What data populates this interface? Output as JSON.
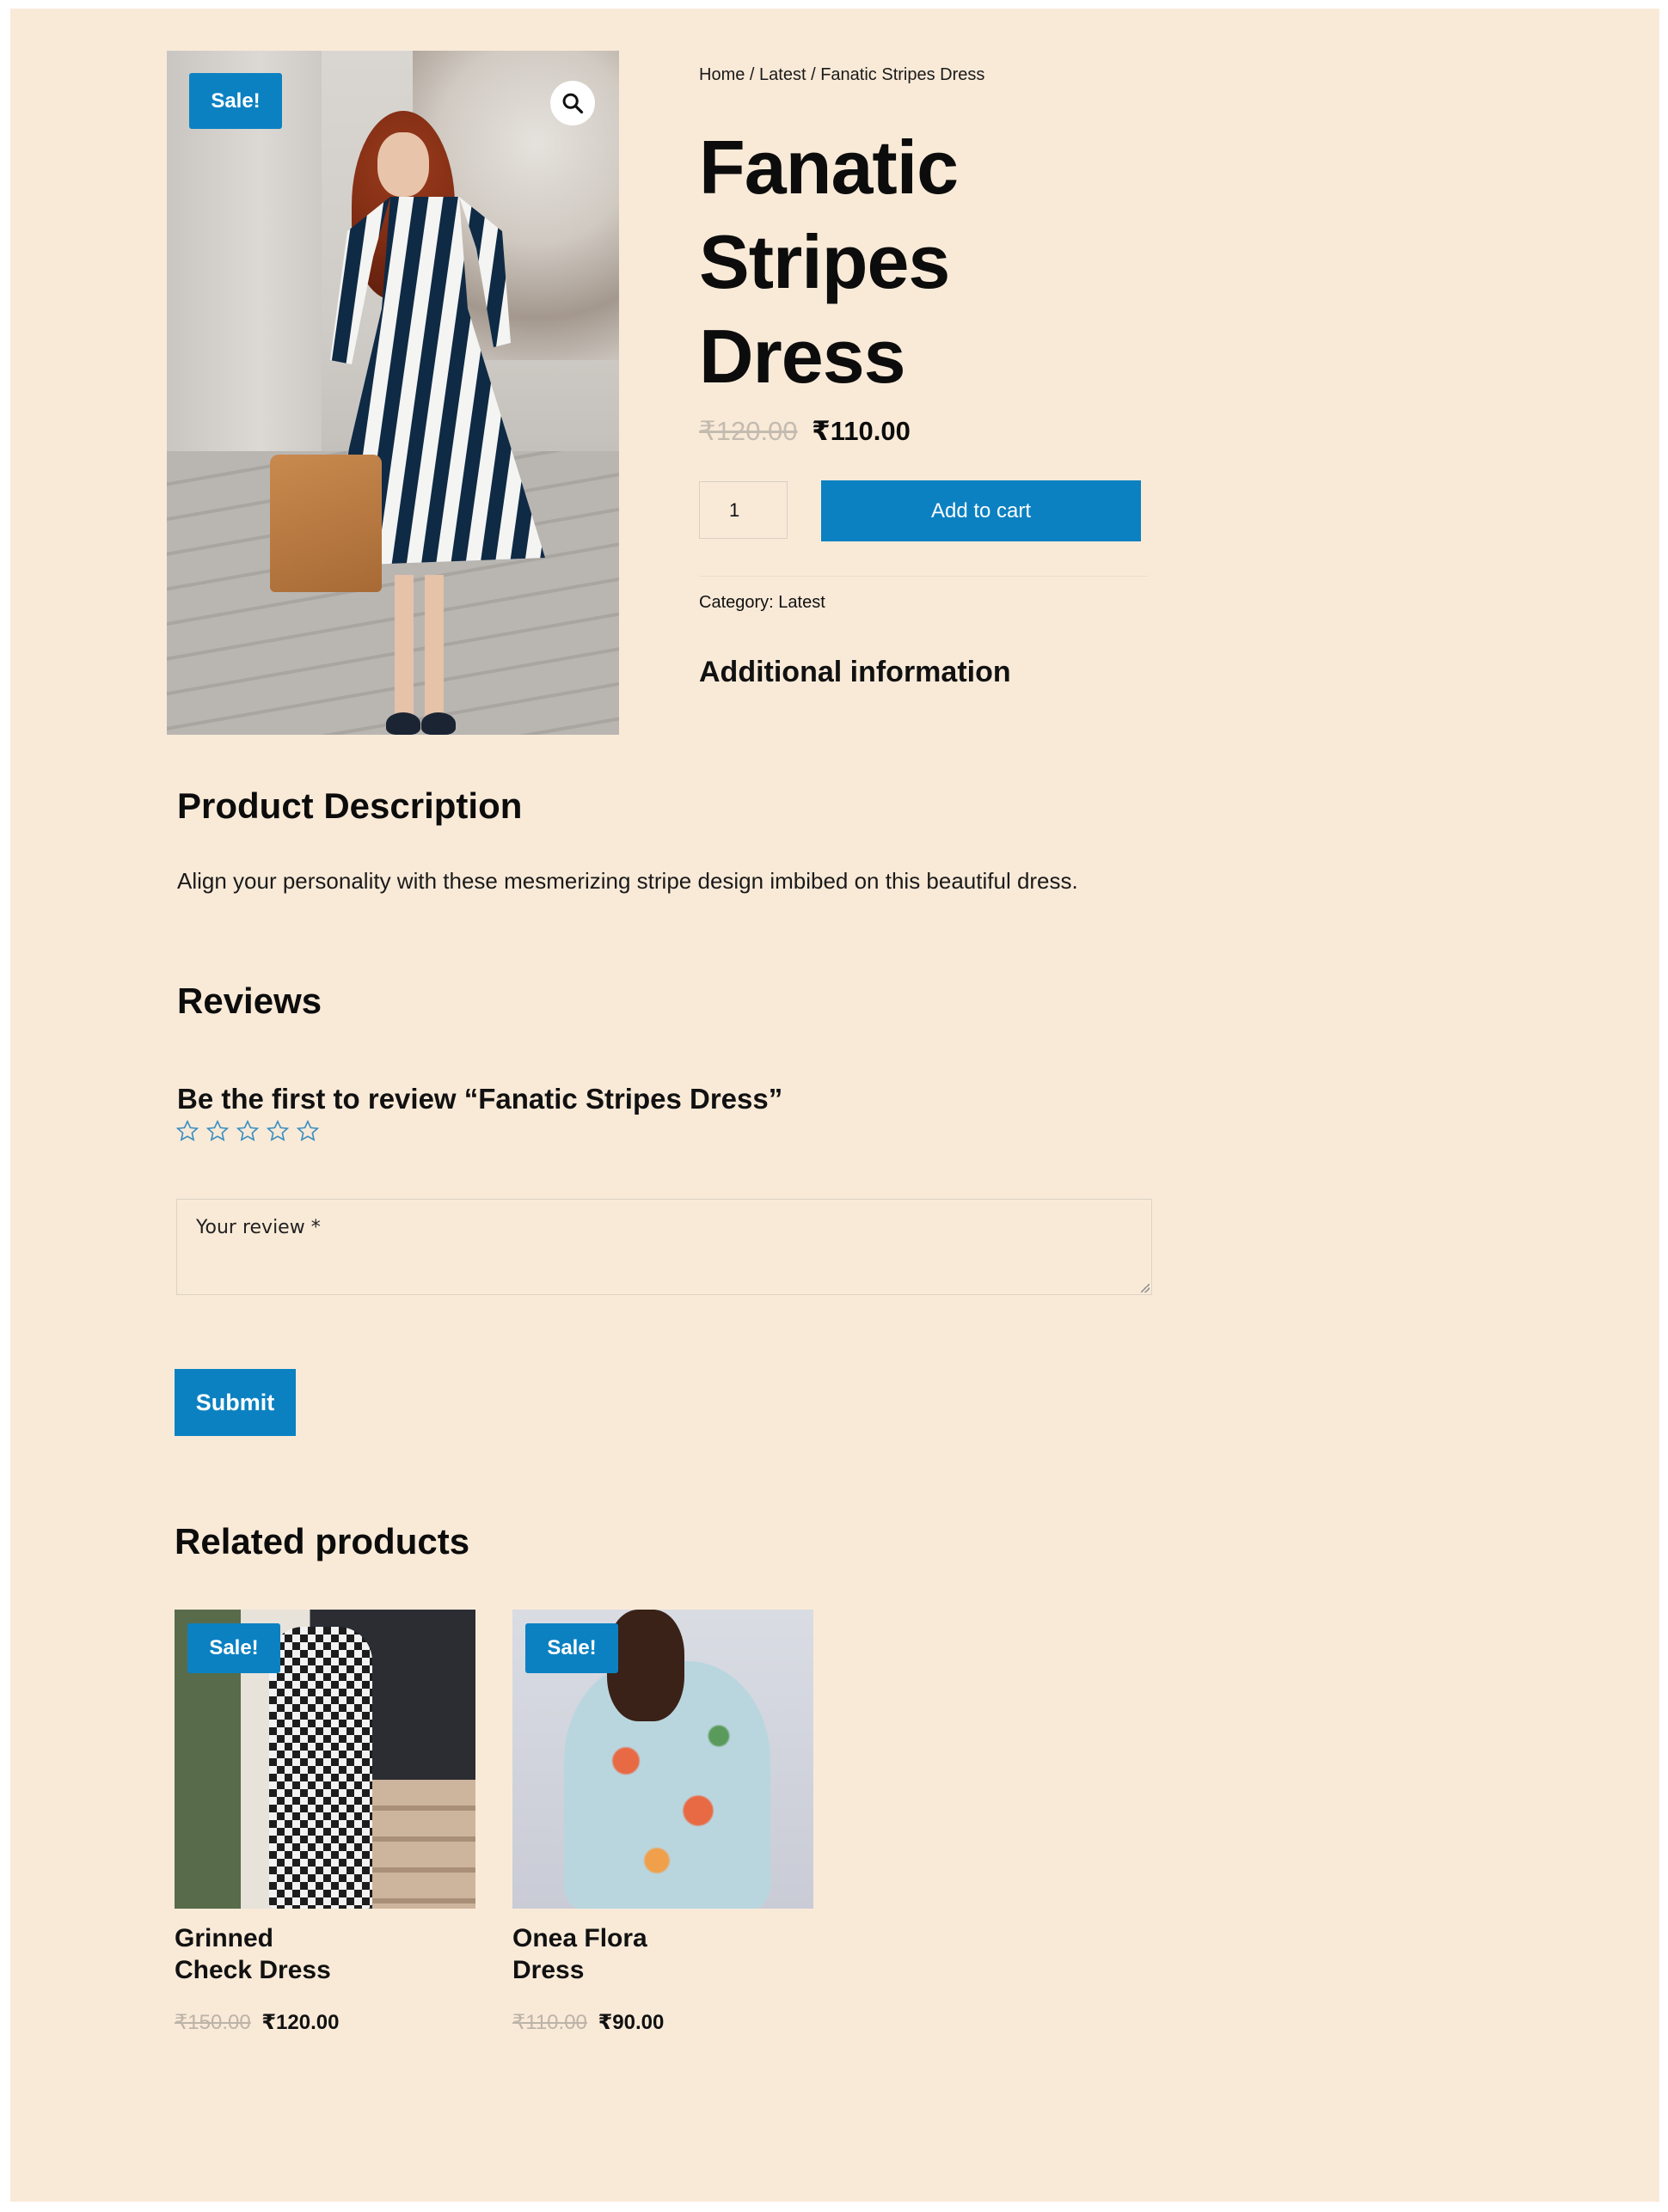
{
  "breadcrumb": {
    "items": [
      "Home",
      "Latest",
      "Fanatic Stripes Dress"
    ],
    "separator": "/"
  },
  "product": {
    "badge": "Sale!",
    "title_lines": [
      "Fanatic",
      "Stripes",
      "Dress"
    ],
    "old_price": "₹120.00",
    "price": "₹110.00",
    "quantity": "1",
    "add_to_cart_label": "Add to cart",
    "category_label": "Category:",
    "category_value": "Latest",
    "additional_info_heading": "Additional information"
  },
  "description": {
    "heading": "Product Description",
    "text": "Align your personality with these mesmerizing stripe design imbibed on this beautiful dress."
  },
  "reviews": {
    "heading": "Reviews",
    "subheading": "Be the first to review “Fanatic Stripes Dress”",
    "stars_total": 5,
    "rating_selected": 0,
    "review_placeholder": "Your review *",
    "submit_label": "Submit"
  },
  "related": {
    "heading": "Related products",
    "items": [
      {
        "badge": "Sale!",
        "title_lines": [
          "Grinned",
          "Check Dress"
        ],
        "old_price": "₹150.00",
        "price": "₹120.00"
      },
      {
        "badge": "Sale!",
        "title_lines": [
          "Onea Flora",
          "Dress"
        ],
        "old_price": "₹110.00",
        "price": "₹90.00"
      }
    ]
  },
  "colors": {
    "accent": "#0b81c2",
    "background": "#f9ead8",
    "star": "#3a8fc0",
    "old_price": "#c4bbb0"
  },
  "icons": {
    "zoom": "magnifier-icon",
    "star": "star-outline-icon",
    "resize": "resize-handle-icon"
  }
}
